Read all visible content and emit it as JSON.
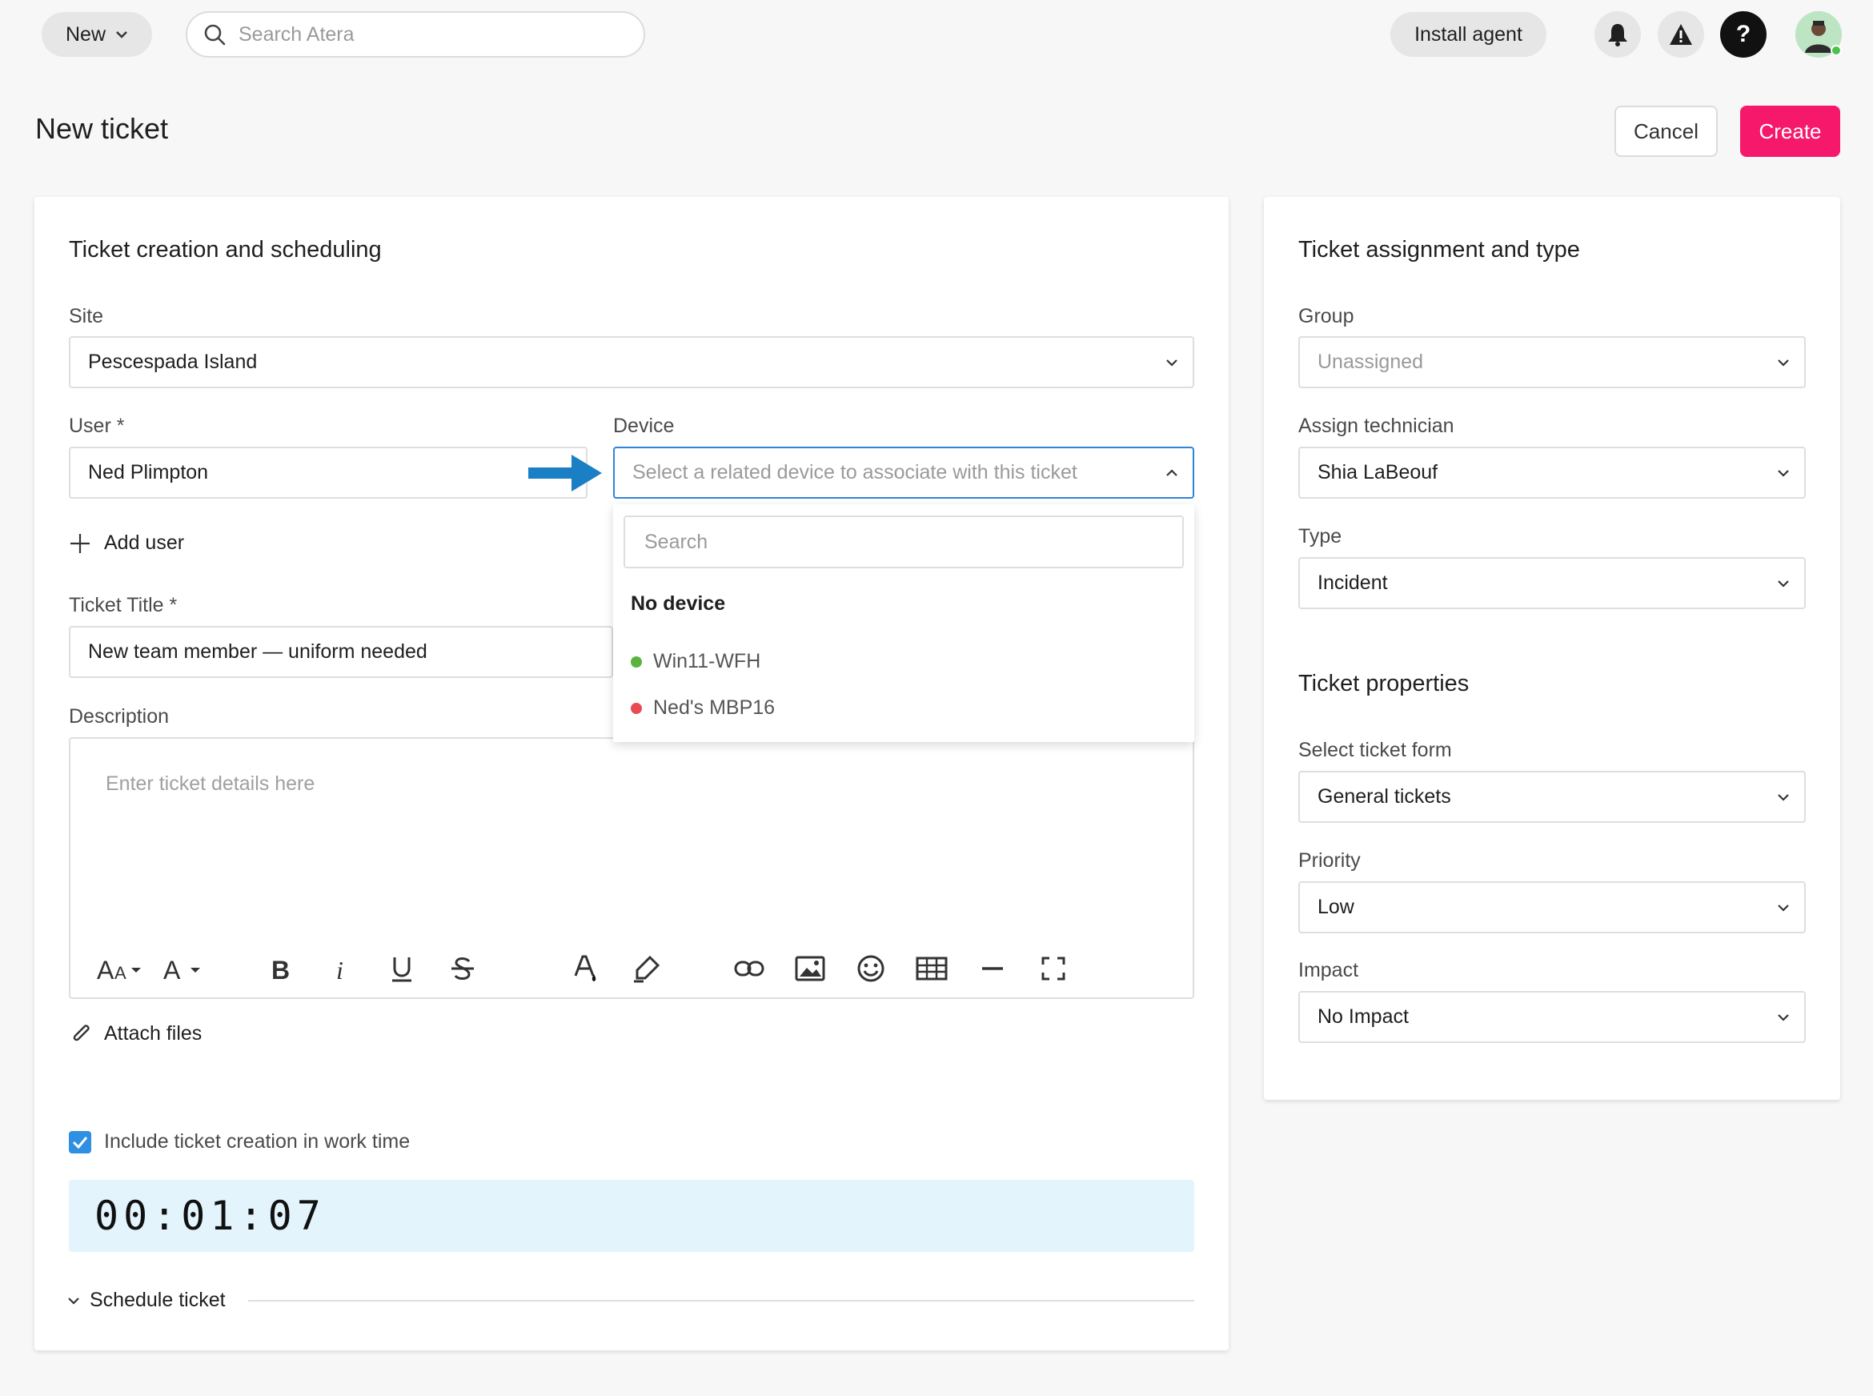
{
  "topbar": {
    "new_label": "New",
    "search_placeholder": "Search Atera",
    "install_agent_label": "Install agent",
    "help_label": "?"
  },
  "page": {
    "title": "New ticket",
    "cancel_label": "Cancel",
    "create_label": "Create"
  },
  "left": {
    "title": "Ticket creation and scheduling",
    "site_label": "Site",
    "site_value": "Pescespada Island",
    "user_label": "User *",
    "user_value": "Ned Plimpton",
    "device_label": "Device",
    "device_placeholder": "Select a related device to associate with this ticket",
    "add_user_label": "Add user",
    "ticket_title_label": "Ticket Title *",
    "ticket_title_value": "New team member — uniform needed",
    "description_label": "Description",
    "description_placeholder": "Enter ticket details here",
    "attach_label": "Attach files",
    "worktime_label": "Include ticket creation in work time",
    "timer_value": "00:01:07",
    "schedule_label": "Schedule ticket"
  },
  "device_dropdown": {
    "search_placeholder": "Search",
    "no_device_label": "No device",
    "items": [
      {
        "label": "Win11-WFH",
        "status_color": "#5ab33f"
      },
      {
        "label": "Ned's MBP16",
        "status_color": "#e94b55"
      }
    ]
  },
  "right": {
    "title": "Ticket assignment and type",
    "group_label": "Group",
    "group_value": "Unassigned",
    "technician_label": "Assign technician",
    "technician_value": "Shia LaBeouf",
    "type_label": "Type",
    "type_value": "Incident",
    "properties_title": "Ticket properties",
    "form_label": "Select ticket form",
    "form_value": "General tickets",
    "priority_label": "Priority",
    "priority_value": "Low",
    "impact_label": "Impact",
    "impact_value": "No Impact"
  },
  "colors": {
    "accent_pink": "#f5186b",
    "focus_blue": "#2e86d8",
    "arrow_blue": "#1a7fc4",
    "timer_bg": "#e3f4fd"
  }
}
